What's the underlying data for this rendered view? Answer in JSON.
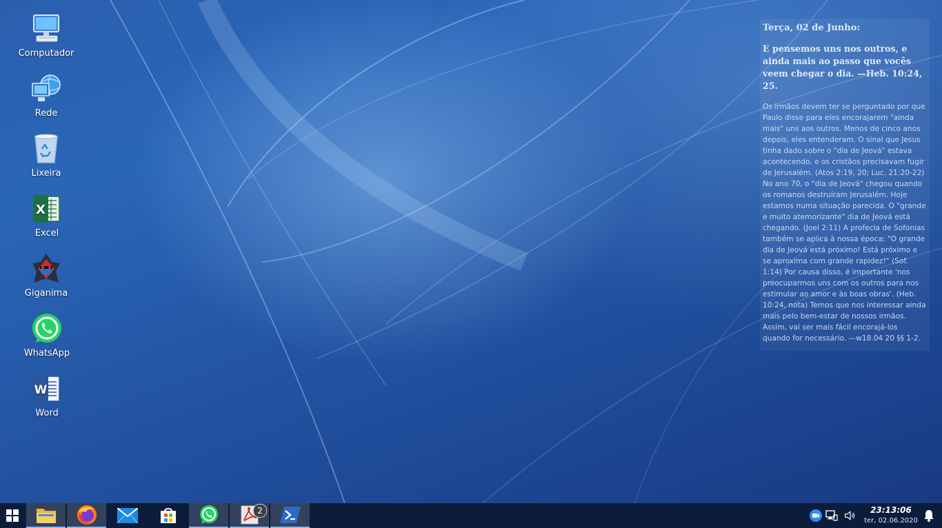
{
  "desktop_icons": [
    {
      "label": "Computador"
    },
    {
      "label": "Rede"
    },
    {
      "label": "Lixeira"
    },
    {
      "label": "Excel"
    },
    {
      "label": "Giganima"
    },
    {
      "label": "WhatsApp"
    },
    {
      "label": "Word"
    }
  ],
  "widget": {
    "date": "Terça, 02 de Junho:",
    "verse": "E pensemos uns nos outros, e ainda mais ao passo que vocês veem chegar o dia. —Heb. 10:24, 25.",
    "body": "Os irmãos devem ter se perguntado por que Paulo disse para eles encorajarem \"ainda mais\" uns aos outros. Menos de cinco anos depois, eles entenderam. O sinal que Jesus tinha dado sobre o \"dia de Jeová\" estava acontecendo, e os cristãos precisavam fugir de Jerusalém. (Atos 2:19, 20; Luc. 21:20-22) No ano 70, o \"dia de Jeová\" chegou quando os romanos destruíram Jerusalém. Hoje estamos numa situação parecida. O \"grande e muito atemorizante\" dia de Jeová está chegando. (Joel 2:11) A profecia de Sofonias também se aplica à nossa época: \"O grande dia de Jeová está próximo! Está próximo e se aproxima com grande rapidez!\" (Sof. 1:14) Por causa disso, é importante 'nos preocuparmos uns com os outros para nos estimular ao amor e às boas obras'. (Heb. 10:24, nota) Temos que nos interessar ainda mais pelo bem-estar de nossos irmãos. Assim, vai ser mais fácil encorajá-los quando for necessário. —w18.04 20 §§ 1-2."
  },
  "taskbar": {
    "start_icon": "windows-logo-icon",
    "apps": [
      {
        "icon": "file-explorer-icon"
      },
      {
        "icon": "firefox-icon"
      },
      {
        "icon": "mail-icon"
      },
      {
        "icon": "store-icon"
      },
      {
        "icon": "whatsapp-icon"
      },
      {
        "icon": "acrobat-icon",
        "badge": "2"
      },
      {
        "icon": "powershell-icon"
      }
    ],
    "tray": [
      "zoom-icon",
      "network-icon",
      "volume-icon"
    ],
    "clock": {
      "time": "23:13:06",
      "date": "ter, 02.06.2020"
    },
    "notification_icon": "bell-icon"
  },
  "colors": {
    "taskbar": "#0c1d3c",
    "desktop_accent": "#2a66b8",
    "excel_green": "#1e7145",
    "word_blue": "#2b579a",
    "whatsapp_green": "#25d366"
  }
}
